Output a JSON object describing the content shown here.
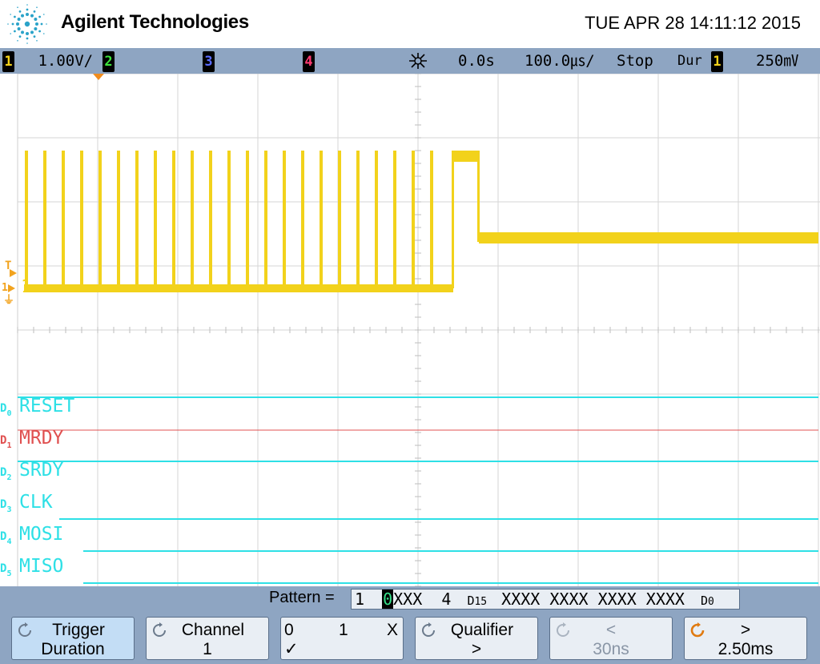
{
  "header": {
    "brand": "Agilent Technologies",
    "datetime": "TUE APR 28 14:11:12 2015"
  },
  "status": {
    "ch1_num": "1",
    "ch1_scale": "1.00V/",
    "ch2_num": "2",
    "ch3_num": "3",
    "ch4_num": "4",
    "delay": "0.0s",
    "timebase": "100.0㎲/",
    "run_state": "Stop",
    "trigger_mode": "Dur",
    "trigger_src": "1",
    "trigger_level": "250㎷",
    "colors": {
      "ch1": "#f2d21b",
      "ch2": "#3ce33c",
      "ch3": "#5b6dff",
      "ch4": "#ff3b73",
      "digital": "#2ee0e6",
      "mrdy": "#e05050"
    }
  },
  "markers": {
    "trigger": "T",
    "ch1": "1",
    "ground": "⏚"
  },
  "digital": [
    {
      "num": "0",
      "name": "RESET",
      "color": "#2ee0e6"
    },
    {
      "num": "1",
      "name": "MRDY",
      "color": "#e05050"
    },
    {
      "num": "2",
      "name": "SRDY",
      "color": "#2ee0e6"
    },
    {
      "num": "3",
      "name": "CLK",
      "color": "#2ee0e6"
    },
    {
      "num": "4",
      "name": "MOSI",
      "color": "#2ee0e6"
    },
    {
      "num": "5",
      "name": "MISO",
      "color": "#2ee0e6"
    }
  ],
  "digital_prefix": "D",
  "pattern": {
    "label": "Pattern =",
    "ch1_val": "1",
    "cursor_digit": "0",
    "rest": "XXX  4",
    "d15_label": "D",
    "d15_sub": "15",
    "digits": "XXXX XXXX XXXX XXXX",
    "d0_label": "D",
    "d0_sub": "0"
  },
  "softkeys": [
    {
      "line1": "Trigger",
      "line2": "Duration",
      "active": true
    },
    {
      "line1": "Channel",
      "line2": "1"
    },
    {
      "line1a": "0",
      "line1b": "1",
      "line1c": "X",
      "line2": "✓"
    },
    {
      "line1": "Qualifier",
      "line2": ">"
    },
    {
      "line1": "<",
      "line2": "30ns",
      "disabled": true
    },
    {
      "line1": ">",
      "line2": "2.50ms"
    }
  ]
}
